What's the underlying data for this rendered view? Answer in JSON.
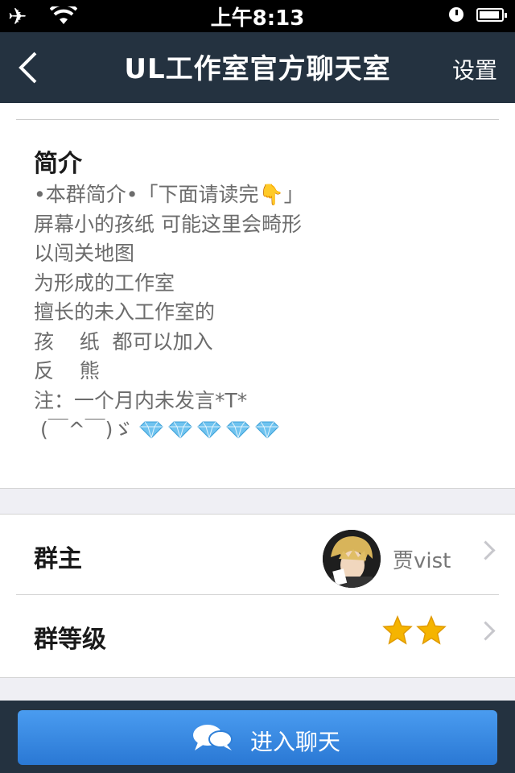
{
  "status_bar": {
    "time": "上午8:13"
  },
  "nav": {
    "title": "UL工作室官方聊天室",
    "settings_label": "设置"
  },
  "intro": {
    "heading": "简介",
    "lines": [
      "•本群简介•「下面请读完👇」",
      "屏幕小的孩纸 可能这里会畸形",
      "以闯关地图",
      "为形成的工作室",
      "擅长的未入工作室的",
      "孩    纸  都可以加入",
      "反    熊",
      "注：一个月内未发言*T*",
      "",
      " (￣^￣)ゞ"
    ]
  },
  "rows": {
    "owner": {
      "label": "群主",
      "name": "贾vist"
    },
    "level": {
      "label": "群等级",
      "stars": 2
    }
  },
  "enter_button": {
    "label": "进入聊天"
  },
  "colors": {
    "nav_bg": "#243240",
    "button_blue": "#3a8be3",
    "diamond": "#6fc3ef",
    "star": "#f5b400"
  }
}
